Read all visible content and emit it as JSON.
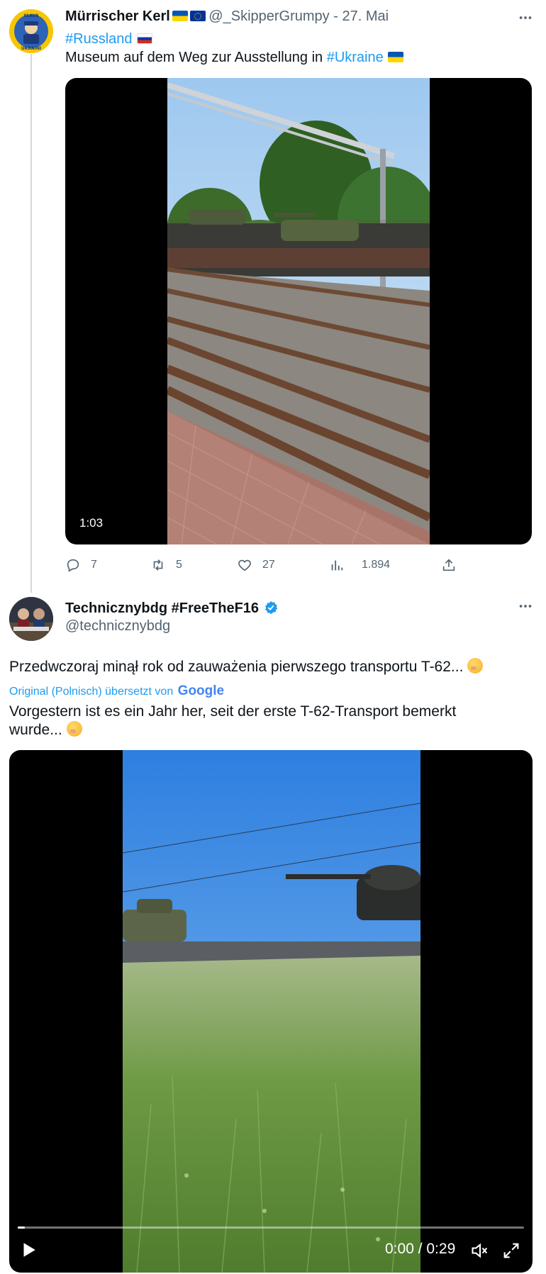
{
  "tweet1": {
    "author_name": "Mürrischer Kerl",
    "handle": "@_SkipperGrumpy",
    "separator": " - ",
    "date": "27. Mai",
    "hashtag_russia": "#Russland",
    "text_before_link": "Museum auf dem Weg zur Ausstellung in ",
    "hashtag_ukraine": "#Ukraine",
    "video_duration": "1:03",
    "replies": "7",
    "retweets": "5",
    "likes": "27",
    "views": "1.894",
    "avatar_text": "SLAVA UKRAINI"
  },
  "tweet2": {
    "author_name": "Technicznybdg #FreeTheF16",
    "handle": "@technicznybdg",
    "original_text": "Przedwczoraj minął rok od zauważenia pierwszego transportu T-62...",
    "translation_note": "Original (Polnisch) übersetzt von",
    "translation_provider": "Google",
    "translated_text": "Vorgestern ist es ein Jahr her, seit der erste T-62-Transport bemerkt wurde...",
    "video_time": "0:00 / 0:29"
  },
  "colors": {
    "accent": "#1d9bf0",
    "muted": "#536471",
    "text": "#0f1419",
    "verified": "#1d9bf0"
  },
  "icons": [
    "more-icon",
    "reply-icon",
    "retweet-icon",
    "like-icon",
    "views-icon",
    "share-icon",
    "verified-icon",
    "play-icon",
    "mute-icon",
    "fullscreen-icon"
  ]
}
